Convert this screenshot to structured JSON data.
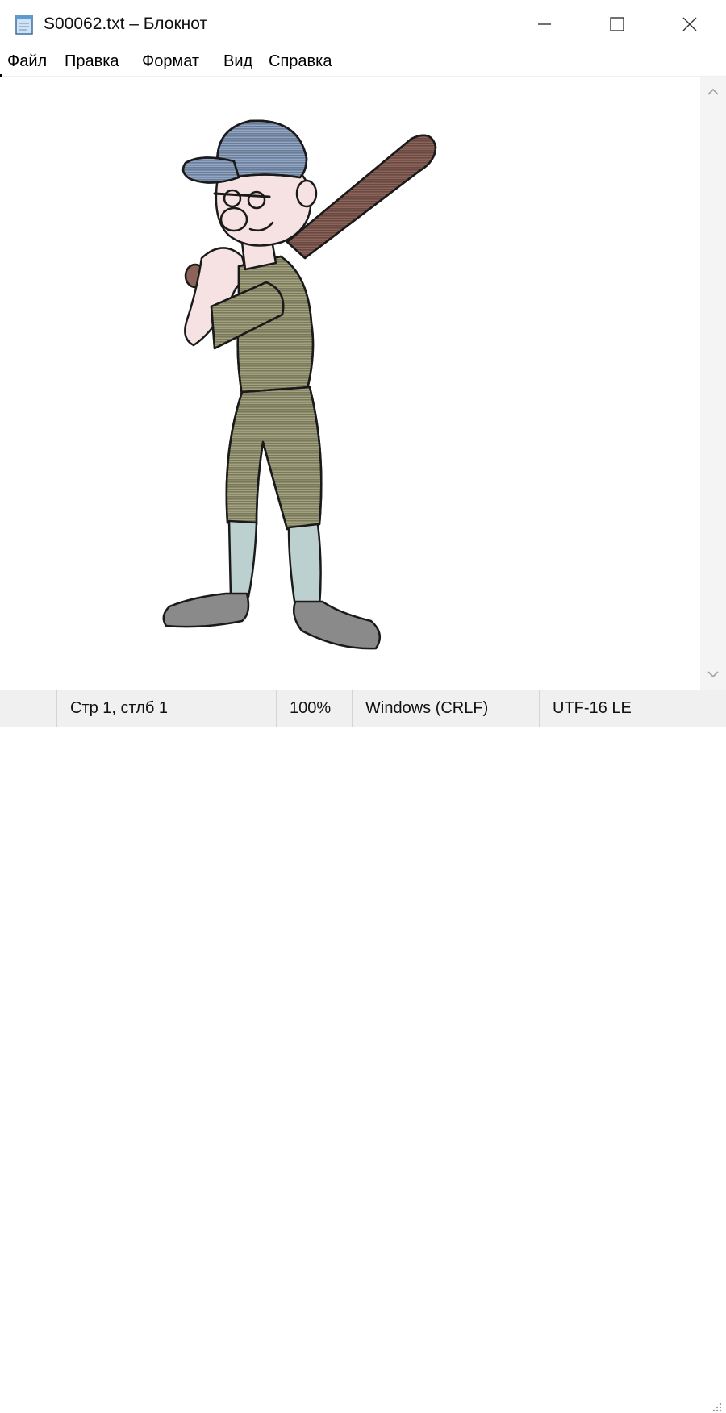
{
  "window": {
    "title": "S00062.txt – Блокнот",
    "icon": "notepad-icon",
    "controls": [
      "minimize-icon",
      "maximize-icon",
      "close-icon"
    ]
  },
  "menu": {
    "items": [
      "Файл",
      "Правка",
      "Формат",
      "Вид",
      "Справка"
    ]
  },
  "editor": {
    "art": "baseball-player-ascii-art",
    "colors": {
      "cap": "#8fa6c6",
      "uniform": "#a3a27e",
      "bat": "#8c6358",
      "socks": "#bcd0d0",
      "shoes": "#8a8a8a",
      "skin": "#f6e2e2"
    }
  },
  "status": {
    "position": "Стр 1, стлб 1",
    "zoom": "100%",
    "line_endings": "Windows (CRLF)",
    "encoding": "UTF-16 LE"
  }
}
